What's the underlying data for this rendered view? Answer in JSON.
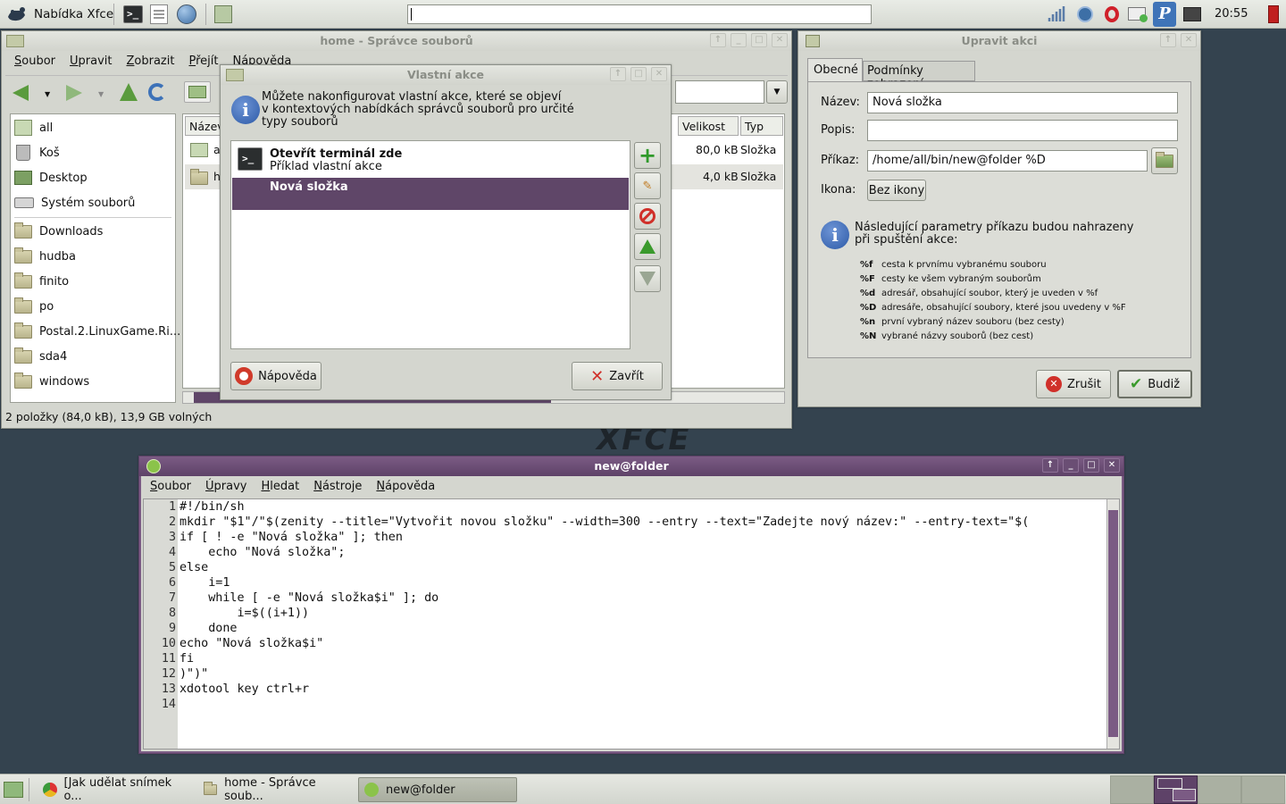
{
  "top_panel": {
    "menu_label": "Nabídka Xfce",
    "clock": "20:55",
    "search_value": ""
  },
  "file_manager": {
    "title": "home - Správce souborů",
    "menu": [
      "Soubor",
      "Upravit",
      "Zobrazit",
      "Přejít",
      "Nápověda"
    ],
    "places": [
      "all",
      "Koš",
      "Desktop",
      "Systém souborů"
    ],
    "bookmarks": [
      "Downloads",
      "hudba",
      "finito",
      "po",
      "Postal.2.LinuxGame.Ri...",
      "sda4",
      "windows"
    ],
    "columns": {
      "name": "Název",
      "size": "Velikost",
      "type": "Typ"
    },
    "files": [
      {
        "name": "al",
        "size": "80,0 kB",
        "type": "Složka"
      },
      {
        "name": "h",
        "size": "4,0 kB",
        "type": "Složka"
      }
    ],
    "status": "2 položky (84,0 kB), 13,9 GB volných"
  },
  "custom_actions": {
    "title": "Vlastní akce",
    "info": [
      "Můžete nakonfigurovat vlastní akce, které se objeví",
      "v kontextových nabídkách správců souborů pro určité",
      "typy souborů"
    ],
    "actions": [
      {
        "name": "Otevřít terminál zde",
        "desc": "Příklad vlastní akce"
      },
      {
        "name": "Nová složka",
        "desc": ""
      }
    ],
    "help_label": "Nápověda",
    "close_label": "Zavřít"
  },
  "edit_action": {
    "title": "Upravit akci",
    "tabs": [
      "Obecné",
      "Podmínky zobrazení"
    ],
    "name_label": "Název:",
    "name_value": "Nová složka",
    "desc_label": "Popis:",
    "desc_value": "",
    "cmd_label": "Příkaz:",
    "cmd_value": "/home/all/bin/new@folder %D",
    "icon_label": "Ikona:",
    "icon_button": "Bez ikony",
    "params_info": [
      "Následující parametry příkazu budou nahrazeny",
      "při spuštění akce:"
    ],
    "params": [
      {
        "key": "%f",
        "desc": "cesta k prvnímu vybranému souboru"
      },
      {
        "key": "%F",
        "desc": "cesty ke všem vybraným souborům"
      },
      {
        "key": "%d",
        "desc": "adresář, obsahující soubor, který je uveden v %f"
      },
      {
        "key": "%D",
        "desc": "adresáře, obsahující soubory, které jsou uvedeny v %F"
      },
      {
        "key": "%n",
        "desc": "první vybraný název souboru (bez cesty)"
      },
      {
        "key": "%N",
        "desc": "vybrané názvy souborů (bez cest)"
      }
    ],
    "cancel_label": "Zrušit",
    "ok_label": "Budiž"
  },
  "editor": {
    "title": "new@folder",
    "menu": [
      "Soubor",
      "Úpravy",
      "Hledat",
      "Nástroje",
      "Nápověda"
    ],
    "lines": [
      "#!/bin/sh",
      "mkdir \"$1\"/\"$(zenity --title=\"Vytvořit novou složku\" --width=300 --entry --text=\"Zadejte nový název:\" --entry-text=\"$(",
      "if [ ! -e \"Nová složka\" ]; then",
      "    echo \"Nová složka\";",
      "else",
      "    i=1",
      "    while [ -e \"Nová složka$i\" ]; do",
      "        i=$((i+1))",
      "    done",
      "echo \"Nová složka$i\"",
      "fi",
      ")\")\"",
      "xdotool key ctrl+r",
      ""
    ]
  },
  "wallpaper_text": "XFCE",
  "taskbar": {
    "tasks": [
      "[Jak udělat snímek o...",
      "home - Správce soub...",
      "new@folder"
    ]
  },
  "colors": {
    "accent": "#5e4268",
    "selection": "#5f4668"
  }
}
